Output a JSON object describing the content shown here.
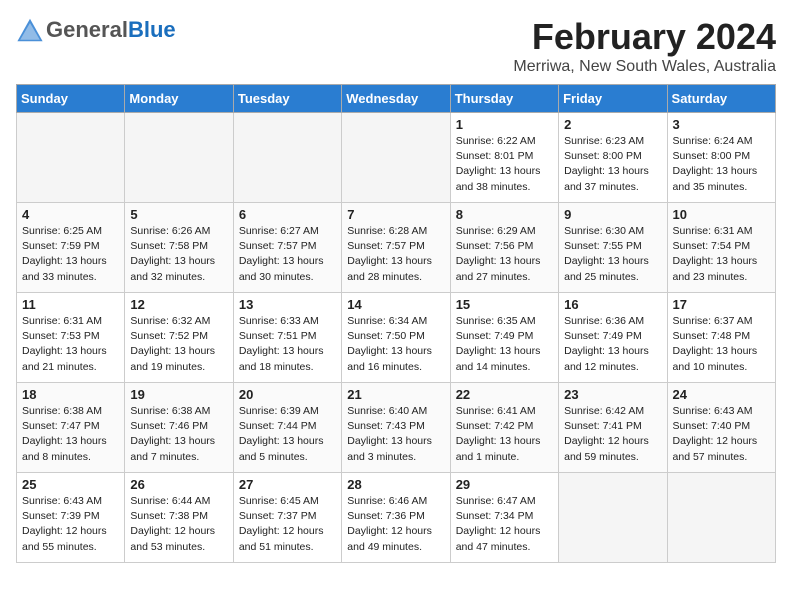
{
  "header": {
    "logo_general": "General",
    "logo_blue": "Blue",
    "month_title": "February 2024",
    "location": "Merriwa, New South Wales, Australia"
  },
  "weekdays": [
    "Sunday",
    "Monday",
    "Tuesday",
    "Wednesday",
    "Thursday",
    "Friday",
    "Saturday"
  ],
  "weeks": [
    [
      {
        "day": "",
        "info": ""
      },
      {
        "day": "",
        "info": ""
      },
      {
        "day": "",
        "info": ""
      },
      {
        "day": "",
        "info": ""
      },
      {
        "day": "1",
        "info": "Sunrise: 6:22 AM\nSunset: 8:01 PM\nDaylight: 13 hours\nand 38 minutes."
      },
      {
        "day": "2",
        "info": "Sunrise: 6:23 AM\nSunset: 8:00 PM\nDaylight: 13 hours\nand 37 minutes."
      },
      {
        "day": "3",
        "info": "Sunrise: 6:24 AM\nSunset: 8:00 PM\nDaylight: 13 hours\nand 35 minutes."
      }
    ],
    [
      {
        "day": "4",
        "info": "Sunrise: 6:25 AM\nSunset: 7:59 PM\nDaylight: 13 hours\nand 33 minutes."
      },
      {
        "day": "5",
        "info": "Sunrise: 6:26 AM\nSunset: 7:58 PM\nDaylight: 13 hours\nand 32 minutes."
      },
      {
        "day": "6",
        "info": "Sunrise: 6:27 AM\nSunset: 7:57 PM\nDaylight: 13 hours\nand 30 minutes."
      },
      {
        "day": "7",
        "info": "Sunrise: 6:28 AM\nSunset: 7:57 PM\nDaylight: 13 hours\nand 28 minutes."
      },
      {
        "day": "8",
        "info": "Sunrise: 6:29 AM\nSunset: 7:56 PM\nDaylight: 13 hours\nand 27 minutes."
      },
      {
        "day": "9",
        "info": "Sunrise: 6:30 AM\nSunset: 7:55 PM\nDaylight: 13 hours\nand 25 minutes."
      },
      {
        "day": "10",
        "info": "Sunrise: 6:31 AM\nSunset: 7:54 PM\nDaylight: 13 hours\nand 23 minutes."
      }
    ],
    [
      {
        "day": "11",
        "info": "Sunrise: 6:31 AM\nSunset: 7:53 PM\nDaylight: 13 hours\nand 21 minutes."
      },
      {
        "day": "12",
        "info": "Sunrise: 6:32 AM\nSunset: 7:52 PM\nDaylight: 13 hours\nand 19 minutes."
      },
      {
        "day": "13",
        "info": "Sunrise: 6:33 AM\nSunset: 7:51 PM\nDaylight: 13 hours\nand 18 minutes."
      },
      {
        "day": "14",
        "info": "Sunrise: 6:34 AM\nSunset: 7:50 PM\nDaylight: 13 hours\nand 16 minutes."
      },
      {
        "day": "15",
        "info": "Sunrise: 6:35 AM\nSunset: 7:49 PM\nDaylight: 13 hours\nand 14 minutes."
      },
      {
        "day": "16",
        "info": "Sunrise: 6:36 AM\nSunset: 7:49 PM\nDaylight: 13 hours\nand 12 minutes."
      },
      {
        "day": "17",
        "info": "Sunrise: 6:37 AM\nSunset: 7:48 PM\nDaylight: 13 hours\nand 10 minutes."
      }
    ],
    [
      {
        "day": "18",
        "info": "Sunrise: 6:38 AM\nSunset: 7:47 PM\nDaylight: 13 hours\nand 8 minutes."
      },
      {
        "day": "19",
        "info": "Sunrise: 6:38 AM\nSunset: 7:46 PM\nDaylight: 13 hours\nand 7 minutes."
      },
      {
        "day": "20",
        "info": "Sunrise: 6:39 AM\nSunset: 7:44 PM\nDaylight: 13 hours\nand 5 minutes."
      },
      {
        "day": "21",
        "info": "Sunrise: 6:40 AM\nSunset: 7:43 PM\nDaylight: 13 hours\nand 3 minutes."
      },
      {
        "day": "22",
        "info": "Sunrise: 6:41 AM\nSunset: 7:42 PM\nDaylight: 13 hours\nand 1 minute."
      },
      {
        "day": "23",
        "info": "Sunrise: 6:42 AM\nSunset: 7:41 PM\nDaylight: 12 hours\nand 59 minutes."
      },
      {
        "day": "24",
        "info": "Sunrise: 6:43 AM\nSunset: 7:40 PM\nDaylight: 12 hours\nand 57 minutes."
      }
    ],
    [
      {
        "day": "25",
        "info": "Sunrise: 6:43 AM\nSunset: 7:39 PM\nDaylight: 12 hours\nand 55 minutes."
      },
      {
        "day": "26",
        "info": "Sunrise: 6:44 AM\nSunset: 7:38 PM\nDaylight: 12 hours\nand 53 minutes."
      },
      {
        "day": "27",
        "info": "Sunrise: 6:45 AM\nSunset: 7:37 PM\nDaylight: 12 hours\nand 51 minutes."
      },
      {
        "day": "28",
        "info": "Sunrise: 6:46 AM\nSunset: 7:36 PM\nDaylight: 12 hours\nand 49 minutes."
      },
      {
        "day": "29",
        "info": "Sunrise: 6:47 AM\nSunset: 7:34 PM\nDaylight: 12 hours\nand 47 minutes."
      },
      {
        "day": "",
        "info": ""
      },
      {
        "day": "",
        "info": ""
      }
    ]
  ]
}
